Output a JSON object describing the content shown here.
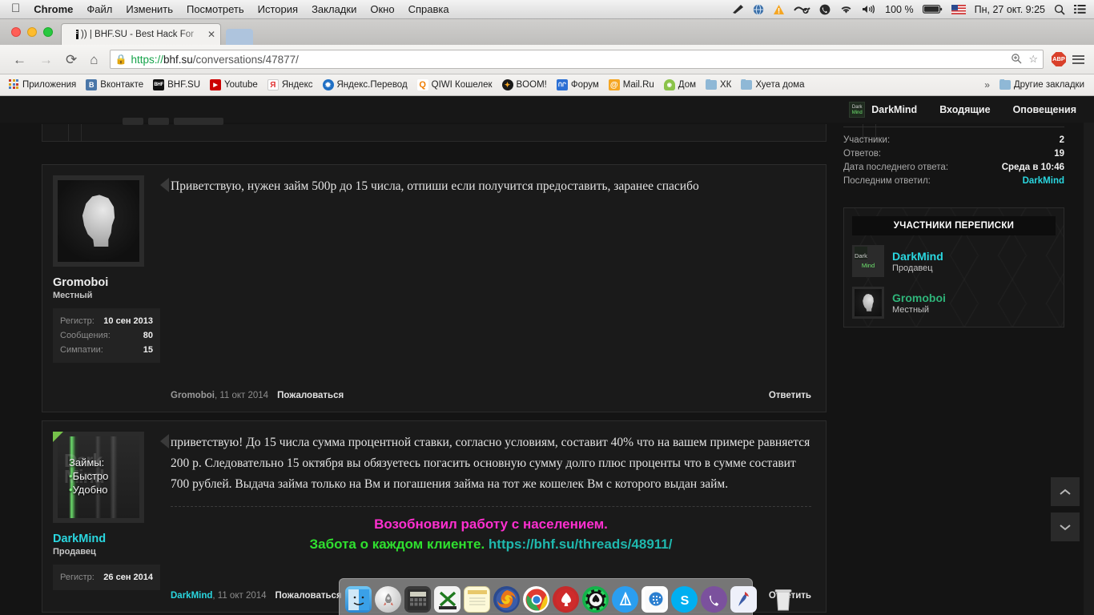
{
  "menubar": {
    "apple": "apple-logo",
    "items": [
      "Chrome",
      "Файл",
      "Изменить",
      "Посмотреть",
      "История",
      "Закладки",
      "Окно",
      "Справка"
    ],
    "battery_pct": "100 %",
    "datetime": "Пн, 27 окт.  9:25",
    "icons": [
      "pen-icon",
      "globe-icon",
      "warning-icon",
      "glasses-icon",
      "viber-icon",
      "wifi-icon",
      "volume-icon",
      "battery-icon",
      "flag-us-icon",
      "search-icon",
      "list-icon"
    ]
  },
  "browser": {
    "tab_title": ")) | BHF.SU - Best Hack For",
    "tab_favicon_text": "BHF",
    "close_label": "✕",
    "url_scheme": "https://",
    "url_host": "bhf.su",
    "url_path": "/conversations/47877/",
    "back_icon": "←",
    "forward_icon": "→",
    "reload_icon": "⟳",
    "home_icon": "⌂",
    "zoom_icon": "zoom-icon",
    "star_icon": "☆",
    "abp_label": "ABP"
  },
  "bookmarks": {
    "items": [
      {
        "label": "Приложения",
        "icon": "apps-grid-icon"
      },
      {
        "label": "Вконтакте",
        "icon": "vk-icon",
        "color": "#4a76a8",
        "glyph": "В"
      },
      {
        "label": "BHF.SU",
        "icon": "bhf-icon",
        "color": "#111111",
        "glyph": "BHF"
      },
      {
        "label": "Youtube",
        "icon": "youtube-icon",
        "color": "#cc0000",
        "glyph": "▶"
      },
      {
        "label": "Яндекс",
        "icon": "yandex-icon",
        "color": "#ffffff",
        "glyph": "Я"
      },
      {
        "label": "Яндекс.Перевод",
        "icon": "yandex-translate-icon",
        "color": "#1f6fc4",
        "glyph": "✹"
      },
      {
        "label": "QIWI Кошелек",
        "icon": "qiwi-icon",
        "color": "#ffffff",
        "glyph": "Q"
      },
      {
        "label": "BOOM!",
        "icon": "boom-icon",
        "color": "#1a1a1a",
        "glyph": "✦"
      },
      {
        "label": "Форум",
        "icon": "forum-icon",
        "color": "#2b6fd4",
        "glyph": "ՈՐ"
      },
      {
        "label": "Mail.Ru",
        "icon": "mailru-icon",
        "color": "#f5a623",
        "glyph": "@"
      },
      {
        "label": "Дом",
        "icon": "android-icon",
        "color": "#8bc34a",
        "glyph": "◉"
      },
      {
        "label": "ХК",
        "icon": "folder-icon"
      },
      {
        "label": "Хуета дома",
        "icon": "folder-icon"
      }
    ],
    "overflow": "»",
    "other": {
      "label": "Другие закладки",
      "icon": "folder-icon"
    }
  },
  "site": {
    "nav": {
      "avatar_l1": "Dark",
      "avatar_l2": "Mind",
      "user": "DarkMind",
      "inbox": "Входящие",
      "alerts": "Оповещения"
    },
    "sidebar": {
      "stats": [
        {
          "key": "Участники:",
          "value": "2",
          "accent": false
        },
        {
          "key": "Ответов:",
          "value": "19",
          "accent": false
        },
        {
          "key": "Дата последнего ответа:",
          "value": "Среда в 10:46",
          "accent": false
        },
        {
          "key": "Последним ответил:",
          "value": "DarkMind",
          "accent": true
        }
      ],
      "participants_header": "УЧАСТНИКИ ПЕРЕПИСКИ",
      "participants": [
        {
          "name": "DarkMind",
          "title": "Продавец",
          "color": "cyan",
          "avatar": "darkmind-avatar",
          "av_l1": "Dark",
          "av_l2": "Mind"
        },
        {
          "name": "Gromoboi",
          "title": "Местный",
          "color": "green",
          "avatar": "default-head-avatar"
        }
      ]
    },
    "posts": [
      {
        "user": "Gromoboi",
        "user_color": "white",
        "title": "Местный",
        "avatar": "default-head-avatar",
        "stats": [
          {
            "key": "Регистр:",
            "value": "10 сен 2013"
          },
          {
            "key": "Сообщения:",
            "value": "80"
          },
          {
            "key": "Симпатии:",
            "value": "15"
          }
        ],
        "message": "Приветствую, нужен займ 500р до 15 числа, отпиши если получится предоставить, заранее спасибо",
        "footer_user": "Gromoboi",
        "footer_date": ", 11 окт 2014",
        "report": "Пожаловаться",
        "reply": "Ответить"
      },
      {
        "user": "DarkMind",
        "user_color": "cyan",
        "title": "Продавец",
        "avatar": "darkmind-avatar",
        "avatar_heading": "Займы:",
        "avatar_item1": "Быстро",
        "avatar_item2": "Удобно",
        "avatar_ghost": "Dark Mind",
        "stats": [
          {
            "key": "Регистр:",
            "value": "26 сен 2014"
          }
        ],
        "message": "приветствую! До 15 числа сумма процентной ставки, согласно условиям, составит 40% что на вашем примере равняется 200 р. Следовательно 15 октября вы обязуетесь погасить основную сумму долго плюс проценты что в сумме составит 700 рублей. Выдача займа только на Вм и погашения займа на тот же кошелек Вм с которого выдан займ.",
        "signature_line1": "Возобновил работу с населением.",
        "signature_line2": "Забота о каждом клиенте.",
        "signature_link": "https://bhf.su/threads/48911/",
        "footer_user": "DarkMind",
        "footer_date": ", 11 окт 2014",
        "report": "Пожаловаться",
        "reply": "Ответить"
      }
    ],
    "scroll": {
      "up": "⌃",
      "down": "⌄"
    },
    "colors": {
      "accent_cyan": "#2ad7e0",
      "accent_green": "#2fb57a",
      "sig_magenta": "#ff2fd0",
      "sig_green": "#2fe02f",
      "sig_link": "#1fb8ae"
    }
  },
  "dock": {
    "items": [
      {
        "name": "finder",
        "glyph": "☺",
        "color": "#3da5f0",
        "running": true
      },
      {
        "name": "launchpad",
        "glyph": "🚀",
        "color": "#c8c8c8",
        "running": false
      },
      {
        "name": "calculator",
        "glyph": "▦",
        "color": "#2b2b2b",
        "running": false
      },
      {
        "name": "keepassx",
        "glyph": "X",
        "color": "#f2f2f2",
        "running": false
      },
      {
        "name": "notes",
        "glyph": "▤",
        "color": "#fdf6c8",
        "running": false
      },
      {
        "name": "firefox",
        "glyph": "◉",
        "color": "#e8751a",
        "running": false
      },
      {
        "name": "chrome",
        "glyph": "◉",
        "color": "#4caf50",
        "running": true
      },
      {
        "name": "pokerstars",
        "glyph": "♠",
        "color": "#d42b2b",
        "running": false
      },
      {
        "name": "poker-chip",
        "glyph": "♠",
        "color": "#12b34a",
        "running": false
      },
      {
        "name": "app-store",
        "glyph": "A",
        "color": "#2b9ef0",
        "running": false
      },
      {
        "name": "blue-app",
        "glyph": "▩",
        "color": "#2b7fd0",
        "running": true
      },
      {
        "name": "skype",
        "glyph": "S",
        "color": "#00aff0",
        "running": true
      },
      {
        "name": "viber",
        "glyph": "✆",
        "color": "#7b519d",
        "running": true
      },
      {
        "name": "paint-app",
        "glyph": "✎",
        "color": "#e8e8f5",
        "running": false
      }
    ],
    "trash": {
      "name": "trash",
      "glyph": "▯"
    }
  }
}
